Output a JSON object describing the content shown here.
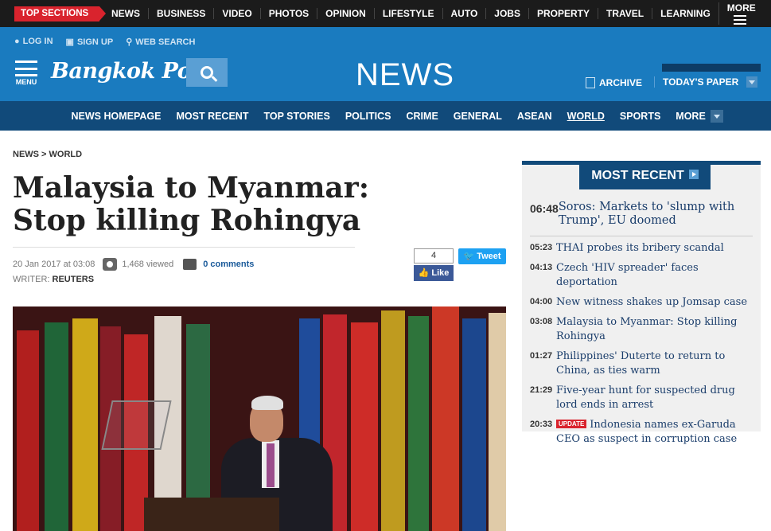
{
  "top_sections": "TOP SECTIONS",
  "top_nav": [
    "NEWS",
    "BUSINESS",
    "VIDEO",
    "PHOTOS",
    "OPINION",
    "LIFESTYLE",
    "AUTO",
    "JOBS",
    "PROPERTY",
    "TRAVEL",
    "LEARNING",
    "MORE"
  ],
  "user_bar": {
    "login": "LOG IN",
    "signup": "SIGN UP",
    "search": "WEB SEARCH"
  },
  "header": {
    "menu": "MENU",
    "logo": "Bangkok Post",
    "section": "NEWS",
    "archive": "ARCHIVE",
    "todays_paper": "TODAY'S PAPER"
  },
  "section_nav": [
    "NEWS HOMEPAGE",
    "MOST RECENT",
    "TOP STORIES",
    "POLITICS",
    "CRIME",
    "GENERAL",
    "ASEAN",
    "WORLD",
    "SPORTS",
    "MORE"
  ],
  "article": {
    "breadcrumb": "NEWS > WORLD",
    "headline": "Malaysia to Myanmar: Stop killing Rohingya",
    "date": "20 Jan 2017 at 03:08",
    "views": "1,468 viewed",
    "comments": "0 comments",
    "writer_label": "WRITER:",
    "writer": "REUTERS",
    "fb_count": "4",
    "fb_like": "Like",
    "tweet": "Tweet"
  },
  "sidebar": {
    "title": "MOST RECENT",
    "top": {
      "time": "06:48",
      "headline": "Soros: Markets to 'slump with Trump', EU doomed"
    },
    "items": [
      {
        "time": "05:23",
        "headline": "THAI probes its bribery scandal"
      },
      {
        "time": "04:13",
        "headline": "Czech 'HIV spreader' faces deportation"
      },
      {
        "time": "04:00",
        "headline": "New witness shakes up Jomsap case"
      },
      {
        "time": "03:08",
        "headline": "Malaysia to Myanmar: Stop killing Rohingya"
      },
      {
        "time": "01:27",
        "headline": "Philippines' Duterte to return to China, as ties warm"
      },
      {
        "time": "21:29",
        "headline": "Five-year hunt for suspected drug lord ends in arrest"
      },
      {
        "time": "20:33",
        "badge": "UPDATE",
        "headline": "Indonesia names ex-Garuda CEO as suspect in corruption case"
      }
    ]
  },
  "colors": {
    "brand_blue": "#1a7bbf",
    "nav_dark": "#114a7a",
    "red": "#d9232d"
  }
}
